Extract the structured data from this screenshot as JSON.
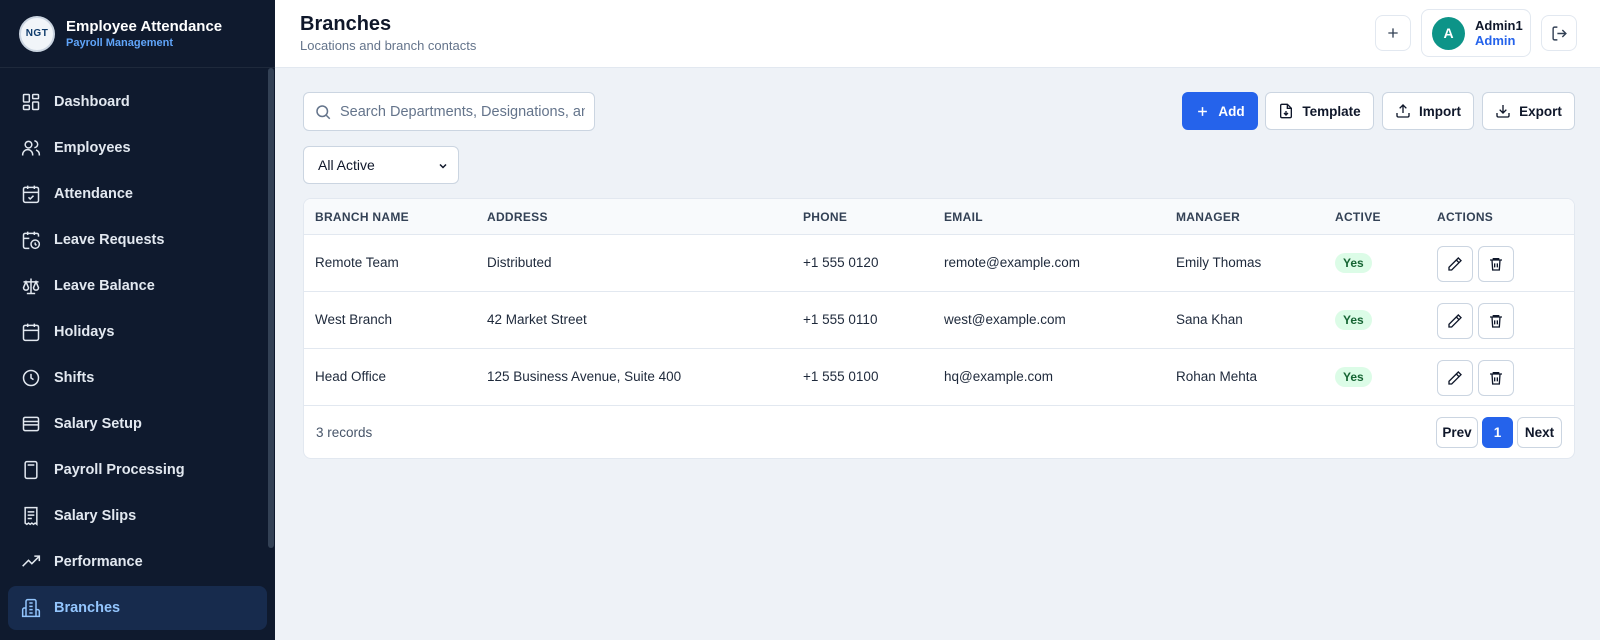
{
  "brand": {
    "logo_text": "NGT",
    "title": "Employee Attendance",
    "subtitle": "Payroll Management"
  },
  "sidebar": {
    "items": [
      {
        "label": "Dashboard",
        "icon": "dashboard-icon"
      },
      {
        "label": "Employees",
        "icon": "users-icon"
      },
      {
        "label": "Attendance",
        "icon": "calendar-check-icon"
      },
      {
        "label": "Leave Requests",
        "icon": "calendar-clock-icon"
      },
      {
        "label": "Leave Balance",
        "icon": "scale-icon"
      },
      {
        "label": "Holidays",
        "icon": "calendar-days-icon"
      },
      {
        "label": "Shifts",
        "icon": "clock-icon"
      },
      {
        "label": "Salary Setup",
        "icon": "wallet-icon"
      },
      {
        "label": "Payroll Processing",
        "icon": "calculator-icon"
      },
      {
        "label": "Salary Slips",
        "icon": "receipt-icon"
      },
      {
        "label": "Performance",
        "icon": "trending-up-icon"
      },
      {
        "label": "Branches",
        "icon": "building-icon",
        "active": true
      }
    ]
  },
  "header": {
    "title": "Branches",
    "subtitle": "Locations and branch contacts",
    "user": {
      "initial": "A",
      "name": "Admin1",
      "role": "Admin"
    }
  },
  "toolbar": {
    "search_placeholder": "Search Departments, Designations, and Branches",
    "add_label": "Add",
    "template_label": "Template",
    "import_label": "Import",
    "export_label": "Export",
    "filter_selected": "All Active"
  },
  "table": {
    "columns": [
      "BRANCH NAME",
      "ADDRESS",
      "PHONE",
      "EMAIL",
      "MANAGER",
      "ACTIVE",
      "ACTIONS"
    ],
    "rows": [
      {
        "name": "Remote Team",
        "address": "Distributed",
        "phone": "+1 555 0120",
        "email": "remote@example.com",
        "manager": "Emily Thomas",
        "active": "Yes"
      },
      {
        "name": "West Branch",
        "address": "42 Market Street",
        "phone": "+1 555 0110",
        "email": "west@example.com",
        "manager": "Sana Khan",
        "active": "Yes"
      },
      {
        "name": "Head Office",
        "address": "125 Business Avenue, Suite 400",
        "phone": "+1 555 0100",
        "email": "hq@example.com",
        "manager": "Rohan Mehta",
        "active": "Yes"
      }
    ],
    "records_text": "3 records"
  },
  "pagination": {
    "prev_label": "Prev",
    "current_page": "1",
    "next_label": "Next"
  },
  "colors": {
    "sidebar_bg": "#0f1a2e",
    "accent": "#2563eb",
    "active_badge_bg": "#dcfce7",
    "active_badge_text": "#166534",
    "avatar_bg": "#0d9488"
  }
}
